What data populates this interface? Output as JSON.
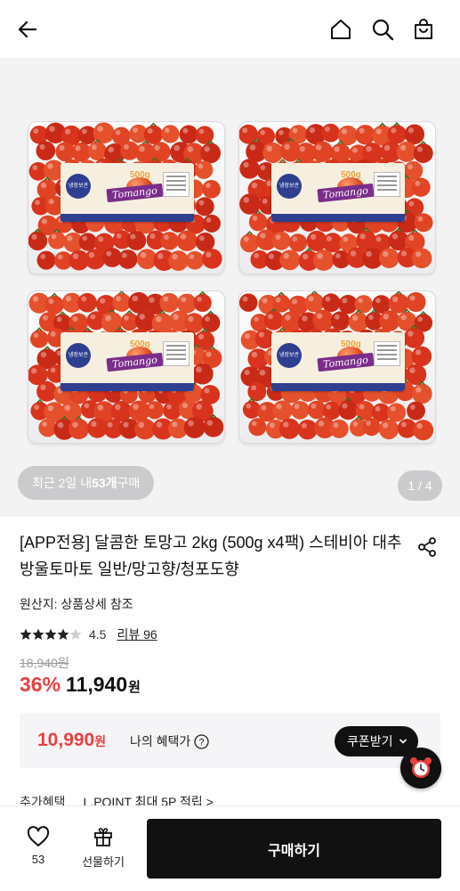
{
  "header": {
    "back_icon": "arrow-left-icon",
    "home_icon": "home-icon",
    "search_icon": "search-icon",
    "cart_icon": "shopping-bag-icon"
  },
  "gallery": {
    "recent_prefix": "최근 2일 내 ",
    "recent_count": "53개",
    "recent_suffix": " 구매",
    "page_indicator": "1 / 4",
    "packs": [
      {
        "badge": "냉장보관",
        "brand": "Tomango",
        "weight": "500g"
      },
      {
        "badge": "냉장보관",
        "brand": "Tomango",
        "weight": "500g"
      },
      {
        "badge": "냉장보관",
        "brand": "Tomango",
        "weight": "500g"
      },
      {
        "badge": "냉장보관",
        "brand": "Tomango",
        "weight": "500g"
      }
    ]
  },
  "product": {
    "title": "[APP전용] 달콤한 토망고 2kg (500g x4팩) 스테비아 대추방울토마토 일반/망고향/청포도향",
    "origin": "원산지: 상품상세 참조",
    "rating": "4.5",
    "review_label": "리뷰 96",
    "original_price": "18,940원",
    "discount": "36%",
    "price": "11,940",
    "price_unit": "원",
    "share_icon": "share-icon"
  },
  "benefit": {
    "price": "10,990",
    "unit": "원",
    "label": "나의 혜택가",
    "coupon_label": "쿠폰받기"
  },
  "extra": {
    "label": "추가혜택",
    "point": "L.POINT 최대 5P 적립 >"
  },
  "bottom": {
    "like_count": "53",
    "gift_label": "선물하기",
    "buy_label": "구매하기"
  },
  "colors": {
    "accent": "#e8403f",
    "dark": "#111111"
  }
}
